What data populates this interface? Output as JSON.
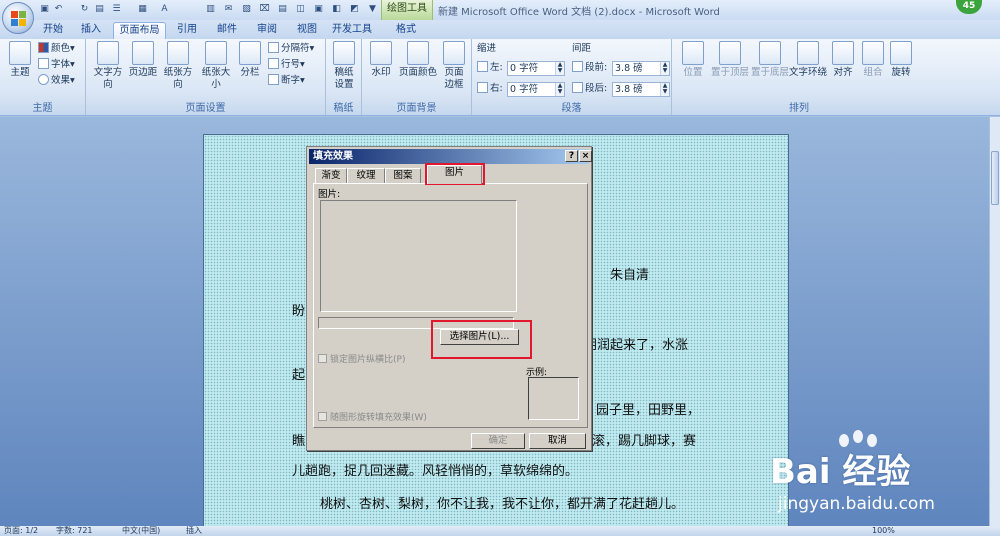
{
  "window": {
    "title": "新建 Microsoft Office Word 文档 (2).docx - Microsoft Word",
    "contextual_tab": "绘图工具",
    "badge": "45"
  },
  "tabs": [
    "开始",
    "插入",
    "页面布局",
    "引用",
    "邮件",
    "审阅",
    "视图",
    "开发工具",
    "格式"
  ],
  "ribbon": {
    "theme": {
      "label": "主题",
      "big": "主题",
      "colors": "颜色",
      "fonts": "字体",
      "effects": "效果"
    },
    "page_setup": {
      "label": "页面设置",
      "text_dir": "文字方向",
      "margins": "页边距",
      "orientation": "纸张方向",
      "size": "纸张大小",
      "columns": "分栏",
      "breaks": "分隔符",
      "line_numbers": "行号",
      "hyphenation": "断字"
    },
    "draft": {
      "label": "稿纸",
      "big": "稿纸\n设置"
    },
    "page_bg": {
      "label": "页面背景",
      "watermark": "水印",
      "page_color": "页面颜色",
      "borders": "页面\n边框"
    },
    "paragraph": {
      "label": "段落",
      "indent": "缩进",
      "left": "左:",
      "right": "右:",
      "left_val": "0 字符",
      "right_val": "0 字符",
      "spacing": "间距",
      "before": "段前:",
      "after": "段后:",
      "before_val": "3.8 磅",
      "after_val": "3.8 磅"
    },
    "arrange": {
      "label": "排列",
      "position": "位置",
      "bring_front": "置于顶层",
      "send_back": "置于底层",
      "wrap": "文字环绕",
      "align": "对齐",
      "group": "组合",
      "rotate": "旋转"
    }
  },
  "document": {
    "author": "朱自清",
    "lines": [
      "盼",
      "朗润起来了，水涨",
      "起",
      "园子里，田野里，",
      "瞧",
      "滚，踢几脚球，赛",
      "儿趟跑，捉几回迷藏。风轻悄悄的，草软绵绵的。",
      "桃树、杏树、梨树，你不让我，我不让你，都开满了花赶趟儿。"
    ]
  },
  "dialog": {
    "title": "填充效果",
    "help": "?",
    "close": "×",
    "tabs": [
      "渐变",
      "纹理",
      "图案",
      "图片"
    ],
    "active_tab": "图片",
    "picture_label": "图片:",
    "select_button": "选择图片(L)...",
    "lock_aspect": "锁定图片纵横比(P)",
    "rotate_with_shape": "随图形旋转填充效果(W)",
    "sample_label": "示例:",
    "ok": "确定",
    "cancel": "取消"
  },
  "statusbar": {
    "page": "页面: 1/2",
    "words": "字数: 721",
    "lang": "中文(中国)",
    "mode": "插入",
    "zoom": "100%"
  },
  "watermark": {
    "brand": "Bai 经验",
    "url": "jingyan.baidu.com"
  }
}
